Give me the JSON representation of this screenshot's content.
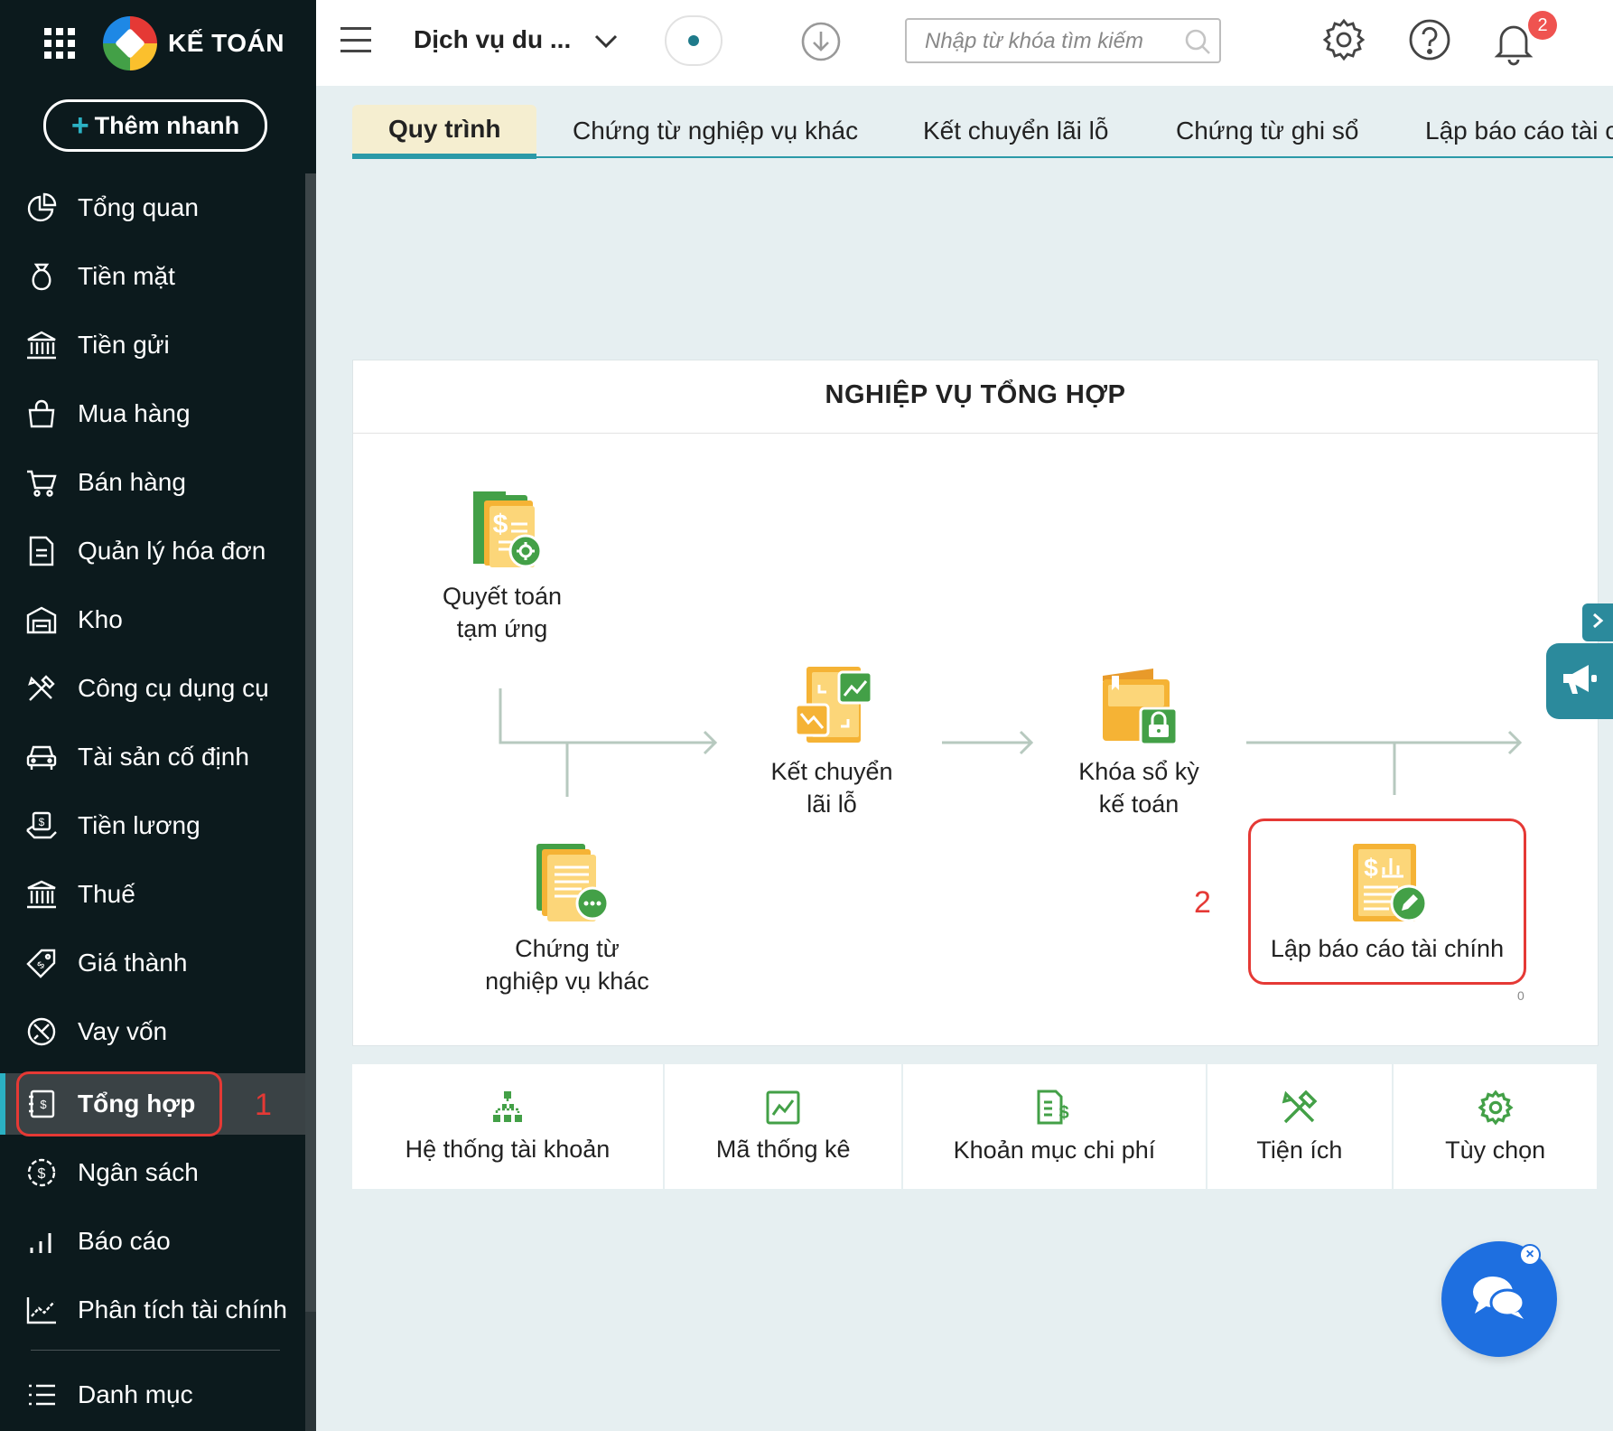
{
  "sidebar": {
    "brand": "KẾ TOÁN",
    "quick_add": "Thêm nhanh",
    "items": [
      {
        "label": "Tổng quan",
        "icon": "pie-chart-icon"
      },
      {
        "label": "Tiền mặt",
        "icon": "money-bag-icon"
      },
      {
        "label": "Tiền gửi",
        "icon": "bank-icon"
      },
      {
        "label": "Mua hàng",
        "icon": "shopping-bag-icon"
      },
      {
        "label": "Bán hàng",
        "icon": "cart-icon"
      },
      {
        "label": "Quản lý hóa đơn",
        "icon": "invoice-icon"
      },
      {
        "label": "Kho",
        "icon": "warehouse-icon"
      },
      {
        "label": "Công cụ dụng cụ",
        "icon": "tools-icon"
      },
      {
        "label": "Tài sản cố định",
        "icon": "car-icon"
      },
      {
        "label": "Tiền lương",
        "icon": "salary-icon"
      },
      {
        "label": "Thuế",
        "icon": "tax-building-icon"
      },
      {
        "label": "Giá thành",
        "icon": "price-tag-icon"
      },
      {
        "label": "Vay vốn",
        "icon": "loan-icon"
      },
      {
        "label": "Tổng hợp",
        "icon": "ledger-icon"
      },
      {
        "label": "Ngân sách",
        "icon": "budget-icon"
      },
      {
        "label": "Báo cáo",
        "icon": "bar-chart-icon"
      },
      {
        "label": "Phân tích tài chính",
        "icon": "analysis-icon"
      },
      {
        "label": "Danh mục",
        "icon": "list-icon"
      }
    ],
    "step_marker": "1"
  },
  "topbar": {
    "org_name": "Dịch vụ du ...",
    "search_placeholder": "Nhập từ khóa tìm kiếm",
    "notification_count": "2"
  },
  "tabs": [
    "Quy trình",
    "Chứng từ nghiệp vụ khác",
    "Kết chuyển lãi lỗ",
    "Chứng từ ghi sổ",
    "Lập báo cáo tài cl"
  ],
  "process": {
    "title": "NGHIỆP VỤ TỔNG HỢP",
    "nodes": {
      "advance_settlement": {
        "line1": "Quyết toán",
        "line2": "tạm ứng"
      },
      "other_vouchers": {
        "line1": "Chứng từ",
        "line2": "nghiệp vụ khác"
      },
      "profit_loss_transfer": {
        "line1": "Kết chuyển",
        "line2": "lãi lỗ"
      },
      "lock_period": {
        "line1": "Khóa sổ kỳ",
        "line2": "kế toán"
      },
      "financial_report": {
        "line1": "Lập báo cáo tài chính"
      }
    },
    "step_marker": "2",
    "tiny_label": "0"
  },
  "shortcuts": [
    "Hệ thống tài khoản",
    "Mã thống kê",
    "Khoản mục chi phí",
    "Tiện ích",
    "Tùy chọn"
  ],
  "colors": {
    "sidebar_bg": "#0c1a1d",
    "accent": "#2b9aa8",
    "highlight": "#e53935",
    "icon_green": "#43a047",
    "icon_orange": "#f5b335"
  }
}
